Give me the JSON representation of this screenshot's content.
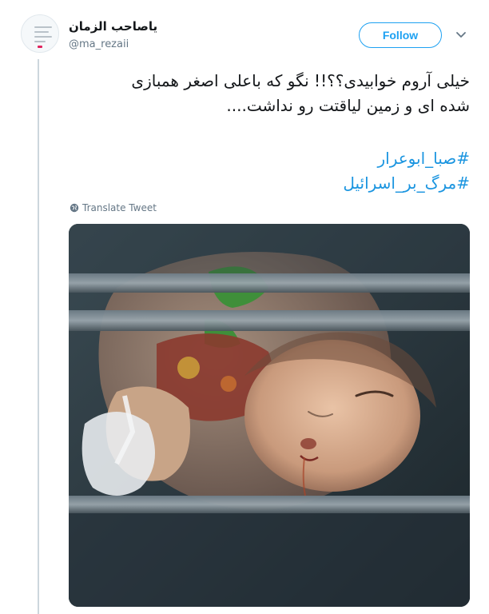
{
  "author": {
    "display_name": "یاصاحب الزمان",
    "handle": "@ma_rezaii"
  },
  "actions": {
    "follow_label": "Follow"
  },
  "tweet": {
    "text_lines": [
      "خیلی آروم خوابیدی؟؟!! نگو که باعلی اصغر همبازی",
      "شده ای و زمین لیاقتت رو نداشت...."
    ],
    "hashtags": [
      "#صبا_ابوعرار",
      "#مرگ_بر_اسرائیل"
    ],
    "translate_label": "Translate Tweet"
  },
  "icons": {
    "avatar": "profile-avatar",
    "menu": "chevron-down-icon",
    "translate": "globe-icon"
  },
  "colors": {
    "link": "#1b95e0",
    "follow": "#1da1f2",
    "muted": "#657786"
  }
}
